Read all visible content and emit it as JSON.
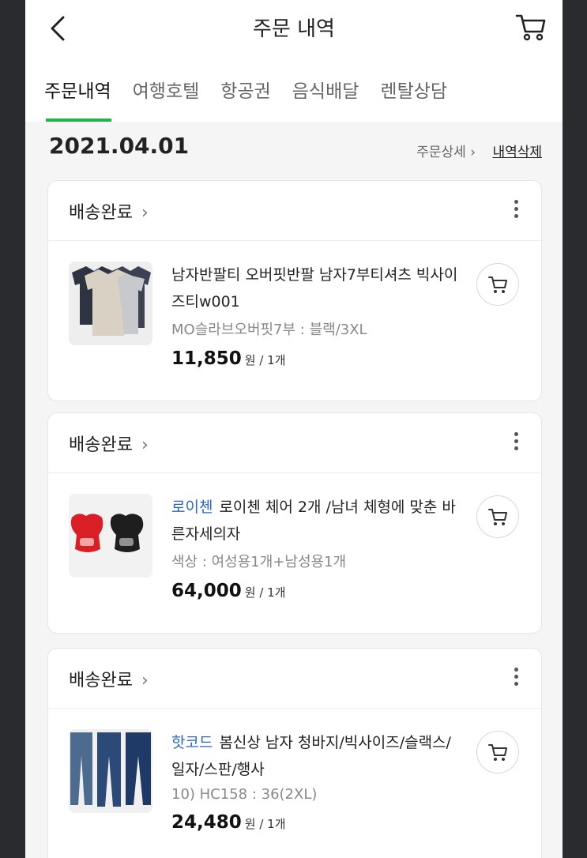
{
  "header": {
    "title": "주문 내역"
  },
  "tabs": [
    {
      "label": "주문내역"
    },
    {
      "label": "여행호텔"
    },
    {
      "label": "항공권"
    },
    {
      "label": "음식배달"
    },
    {
      "label": "렌탈상담"
    }
  ],
  "order": {
    "date": "2021.04.01",
    "detail_link": "주문상세 ›",
    "delete_link": "내역삭제"
  },
  "items": [
    {
      "status": "배송완료",
      "brand": "",
      "name": "남자반팔티 오버핏반팔 남자7부티셔츠 빅사이즈티w001",
      "option": "MO슬라브오버핏7부 : 블랙/3XL",
      "price": "11,850",
      "qty": "원 / 1개"
    },
    {
      "status": "배송완료",
      "brand": "로이첸",
      "name": "로이첸 체어 2개 /남녀 체형에 맞춘 바른자세의자",
      "option": "색상 : 여성용1개+남성용1개",
      "price": "64,000",
      "qty": "원 / 1개"
    },
    {
      "status": "배송완료",
      "brand": "핫코드",
      "name": "봄신상 남자 청바지/빅사이즈/슬랙스/일자/스판/행사",
      "option": "10) HC158 : 36(2XL)",
      "price": "24,480",
      "qty": "원 / 1개"
    }
  ],
  "colors": {
    "accent": "#21b24a",
    "brand_link": "#2c66c4"
  }
}
